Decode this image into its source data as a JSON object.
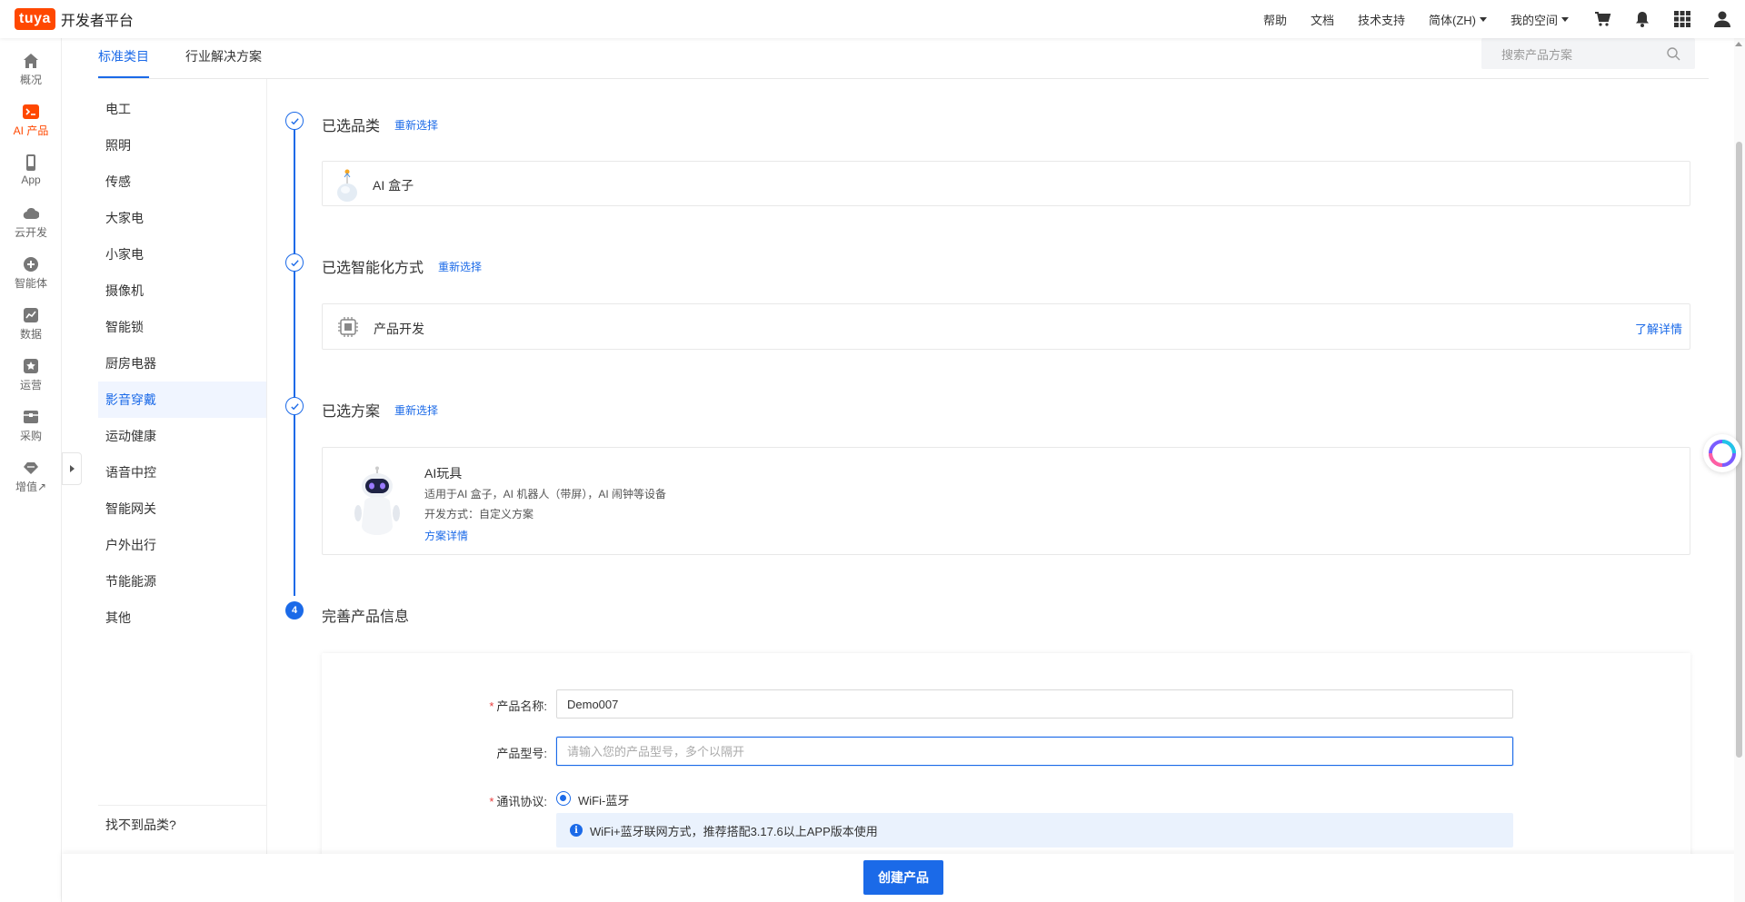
{
  "header": {
    "logo": "tuya",
    "title": "开发者平台",
    "nav": [
      "帮助",
      "文档",
      "技术支持"
    ],
    "language": "简体(ZH)",
    "space": "我的空间",
    "icons": [
      "cart-icon",
      "bell-icon",
      "apps-grid-icon",
      "user-icon"
    ]
  },
  "sidebar": {
    "items": [
      {
        "label": "概况",
        "icon": "home-icon"
      },
      {
        "label": "AI 产品",
        "icon": "terminal-icon"
      },
      {
        "label": "App",
        "icon": "phone-icon"
      },
      {
        "label": "云开发",
        "icon": "cloud-icon"
      },
      {
        "label": "智能体",
        "icon": "plus-circle-icon"
      },
      {
        "label": "数据",
        "icon": "chart-icon"
      },
      {
        "label": "运营",
        "icon": "star-badge-icon"
      },
      {
        "label": "采购",
        "icon": "box-icon"
      },
      {
        "label": "增值↗",
        "icon": "diamond-icon"
      }
    ],
    "active_index": 1
  },
  "tabs": [
    {
      "label": "标准类目"
    },
    {
      "label": "行业解决方案"
    }
  ],
  "search": {
    "placeholder": "搜索产品方案"
  },
  "categories": [
    "电工",
    "照明",
    "传感",
    "大家电",
    "小家电",
    "摄像机",
    "智能锁",
    "厨房电器",
    "影音穿戴",
    "运动健康",
    "语音中控",
    "智能网关",
    "户外出行",
    "节能能源",
    "其他"
  ],
  "active_category": "影音穿戴",
  "cant_find": "找不到品类?",
  "steps": {
    "step1": {
      "title": "已选品类",
      "reselect": "重新选择",
      "item": "AI 盒子"
    },
    "step2": {
      "title": "已选智能化方式",
      "reselect": "重新选择",
      "item": "产品开发",
      "link": "了解详情"
    },
    "step3": {
      "title": "已选方案",
      "reselect": "重新选择",
      "name": "AI玩具",
      "desc": "适用于AI 盒子，AI 机器人（带屏），AI 闹钟等设备",
      "method": "开发方式：自定义方案",
      "link": "方案详情"
    },
    "step4": {
      "number": "4",
      "title": "完善产品信息"
    }
  },
  "form": {
    "name_label": "产品名称:",
    "name_value": "Demo007",
    "model_label": "产品型号:",
    "model_placeholder": "请输入您的产品型号，多个以隔开",
    "protocol_label": "通讯协议:",
    "protocol_option": "WiFi-蓝牙",
    "info_text": "WiFi+蓝牙联网方式，推荐搭配3.17.6以上APP版本使用"
  },
  "footer": {
    "create_button": "创建产品"
  },
  "colors": {
    "brand": "#ff4800",
    "primary": "#1b6ae8",
    "required": "#e83c3c"
  }
}
